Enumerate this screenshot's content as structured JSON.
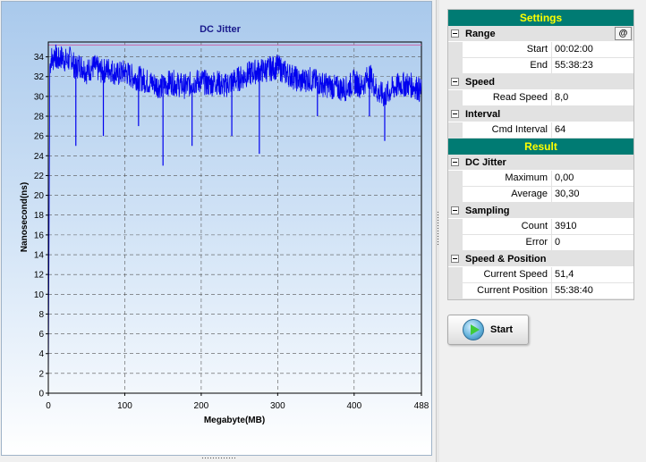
{
  "chart_data": {
    "type": "line",
    "title": "DC Jitter",
    "xlabel": "Megabyte(MB)",
    "ylabel": "Nanosecond(ns)",
    "xlim": [
      0,
      488
    ],
    "ylim": [
      0,
      35.5
    ],
    "x_ticks": [
      0,
      100,
      200,
      300,
      400,
      488
    ],
    "y_ticks": [
      0,
      2,
      4,
      6,
      8,
      10,
      12,
      14,
      16,
      18,
      20,
      22,
      24,
      26,
      28,
      30,
      32,
      34
    ],
    "grid": true,
    "line_color": "#0000ee",
    "reference_line": {
      "y": 35.2,
      "color": "#cc66aa"
    },
    "series": [
      {
        "x": [
          0,
          2,
          4,
          6,
          8,
          12,
          16,
          20,
          25,
          30,
          35,
          40,
          45,
          50,
          55,
          60,
          70,
          80,
          90,
          100,
          110,
          120,
          130,
          140,
          150,
          160,
          170,
          180,
          190,
          200,
          210,
          220,
          230,
          240,
          250,
          260,
          270,
          280,
          290,
          300,
          310,
          320,
          330,
          340,
          350,
          360,
          370,
          380,
          390,
          400,
          410,
          420,
          430,
          440,
          450,
          460,
          470,
          480,
          488
        ],
        "y": [
          0,
          33,
          34,
          33.5,
          34.5,
          33.5,
          34,
          33.8,
          33.5,
          34,
          32.8,
          33.2,
          33,
          32.5,
          32.8,
          33,
          32.5,
          32.8,
          32.2,
          32.5,
          32,
          31.8,
          31.5,
          31.2,
          31,
          31.5,
          31.2,
          31,
          31.4,
          31.6,
          31.2,
          31.5,
          31,
          31.5,
          31.8,
          32.2,
          32.5,
          32.6,
          32.8,
          33,
          32.4,
          32,
          31.5,
          31.8,
          31.5,
          31.2,
          31,
          30.8,
          30.8,
          31.5,
          31,
          32.2,
          30.5,
          30,
          30.8,
          31.2,
          31.2,
          31,
          30.5
        ]
      }
    ],
    "spikes": [
      {
        "x": 36,
        "y": 25.0
      },
      {
        "x": 72,
        "y": 26.0
      },
      {
        "x": 118,
        "y": 27.0
      },
      {
        "x": 150,
        "y": 23.0
      },
      {
        "x": 188,
        "y": 25.0
      },
      {
        "x": 240,
        "y": 26.0
      },
      {
        "x": 276,
        "y": 24.2
      },
      {
        "x": 352,
        "y": 28.0
      },
      {
        "x": 420,
        "y": 28.0
      },
      {
        "x": 440,
        "y": 25.5
      }
    ]
  },
  "settings": {
    "header": "Settings",
    "range": {
      "label": "Range",
      "button_label": "@",
      "start_label": "Start",
      "start_value": "00:02:00",
      "end_label": "End",
      "end_value": "55:38:23"
    },
    "speed": {
      "label": "Speed",
      "read_speed_label": "Read Speed",
      "read_speed_value": "8,0"
    },
    "interval": {
      "label": "Interval",
      "cmd_interval_label": "Cmd Interval",
      "cmd_interval_value": "64"
    }
  },
  "result": {
    "header": "Result",
    "dc_jitter": {
      "label": "DC Jitter",
      "maximum_label": "Maximum",
      "maximum_value": "0,00",
      "average_label": "Average",
      "average_value": "30,30"
    },
    "sampling": {
      "label": "Sampling",
      "count_label": "Count",
      "count_value": "3910",
      "error_label": "Error",
      "error_value": "0"
    },
    "speed_position": {
      "label": "Speed & Position",
      "current_speed_label": "Current Speed",
      "current_speed_value": "51,4",
      "current_position_label": "Current Position",
      "current_position_value": "55:38:40"
    }
  },
  "start_button": {
    "label": "Start",
    "icon": "play-icon"
  }
}
